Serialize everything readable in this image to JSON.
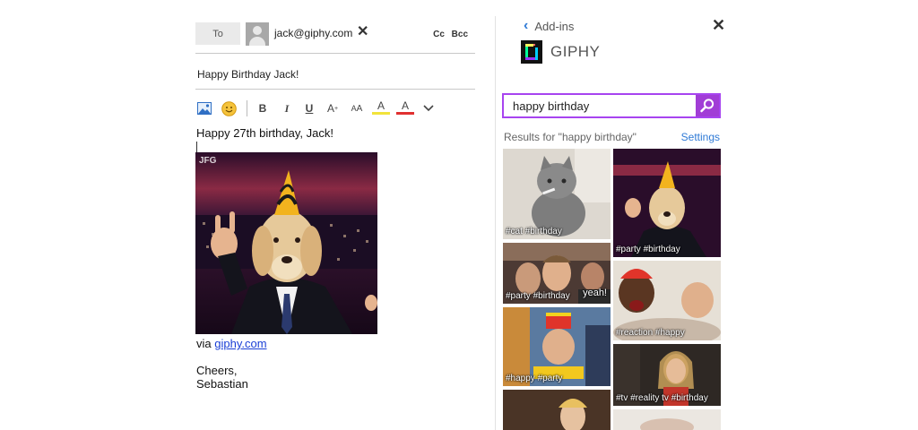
{
  "compose": {
    "to_label": "To",
    "recipient": "jack@giphy.com",
    "cc_bcc": "Cc Bcc",
    "subject": "Happy Birthday Jack!",
    "toolbar": {
      "bold": "B",
      "italic": "I",
      "underline": "U",
      "grow_font": "A",
      "shrink_font": "A",
      "highlight": "A",
      "font_color": "A"
    },
    "greeting": "Happy 27th birthday, Jack!",
    "gif_watermark": "JFG",
    "via_prefix": "via",
    "via_link": "giphy.com",
    "signoff_1": "Cheers,",
    "signoff_2": "Sebastian"
  },
  "addin": {
    "back_label": "Add-ins",
    "app_name": "GIPHY",
    "search_value": "happy birthday",
    "results_label": "Results for \"happy birthday\"",
    "settings_label": "Settings",
    "results": [
      {
        "tags": "#cat #birthday"
      },
      {
        "tags": "#party #birthday"
      },
      {
        "tags": "#party #birthday",
        "caption": "yeah!"
      },
      {
        "tags": "#reaction #happy"
      },
      {
        "tags": "#happy #party"
      },
      {
        "tags": "#tv #reality tv #birthday"
      },
      {
        "tags": ""
      },
      {
        "tags": ""
      }
    ]
  },
  "colors": {
    "accent_purple": "#a13dd6",
    "link_blue": "#1a3fd6",
    "settings_blue": "#2f7ad6"
  },
  "icons": [
    "image-icon",
    "emoji-icon",
    "chevron-down-icon",
    "close-icon",
    "search-icon",
    "chevron-left-icon"
  ]
}
